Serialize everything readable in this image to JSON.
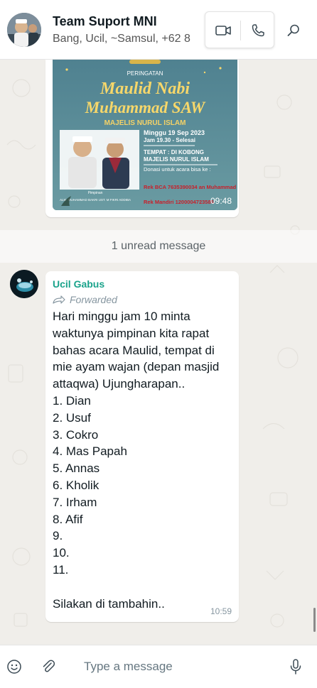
{
  "header": {
    "title": "Team Suport MNI",
    "subtitle": "Bang, Ucil, ~Samsul, +62 8",
    "icons": {
      "video": "video-call-icon",
      "phone": "voice-call-icon",
      "search": "search-icon"
    }
  },
  "poster": {
    "top_label": "PERINGATAN",
    "title_line1": "Maulid Nabi",
    "title_line2": "Muhammad SAW",
    "org": "MAJELIS NURUL ISLAM",
    "date": "Minggu 19 Sep 2023",
    "time_line": "Jam 19.30 - Selesai",
    "venue_label": "TEMPAT : DI KOBONG",
    "venue_name": "MAJELIS NURUL ISLAM",
    "donation": "Donasi untuk acara bisa ke :",
    "bank1": "Rek BCA 7635390034 an Muhammad Fikri Addiba",
    "bank2": "Rek Mandiri 1200004723586",
    "leader_label": "Pimpinan",
    "leader_names": "ALM. MUHAMMAD BAKRI   UST. M FIKRI ADDIBA",
    "time": "09:48"
  },
  "unread": "1 unread message",
  "message": {
    "sender": "Ucil Gabus",
    "forwarded": "Forwarded",
    "body": "Hari minggu jam 10 minta waktunya pimpinan kita rapat bahas acara Maulid, tempat di mie ayam wajan (depan masjid attaqwa) Ujungharapan..\n1. Dian\n2. Usuf\n3. Cokro\n4. Mas Papah\n5. Annas\n6. Kholik\n7. Irham\n8. Afif\n9.\n10.\n11.\n\nSilakan di tambahin..",
    "time": "10:59"
  },
  "composer": {
    "placeholder": "Type a message",
    "icons": {
      "emoji": "emoji-icon",
      "attach": "paperclip-icon",
      "mic": "microphone-icon"
    }
  },
  "colors": {
    "accent": "#1aa38b",
    "chat_bg": "#efeae2",
    "bubble": "#ffffff"
  }
}
